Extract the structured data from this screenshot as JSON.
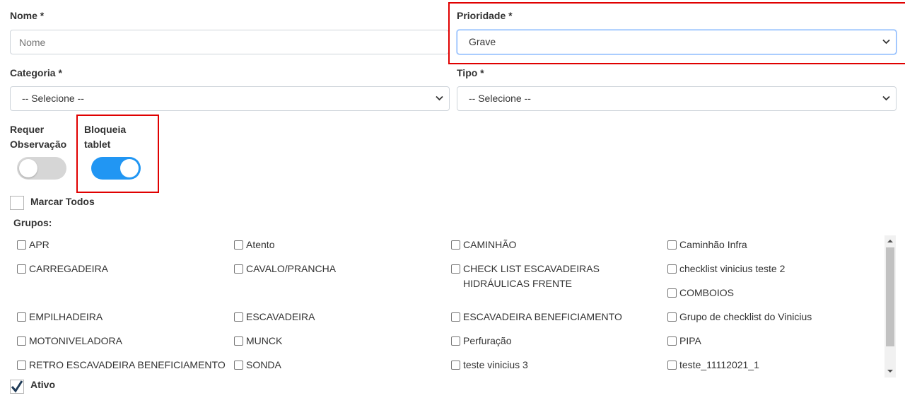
{
  "form": {
    "nome": {
      "label": "Nome *",
      "placeholder": "Nome",
      "value": ""
    },
    "prioridade": {
      "label": "Prioridade *",
      "value": "Grave"
    },
    "categoria": {
      "label": "Categoria *",
      "value": "-- Selecione --"
    },
    "tipo": {
      "label": "Tipo *",
      "value": "-- Selecione --"
    },
    "requer_observacao": {
      "label_line1": "Requer",
      "label_line2": "Observação",
      "checked": false
    },
    "bloqueia_tablet": {
      "label_line1": "Bloqueia",
      "label_line2": "tablet",
      "checked": true
    },
    "marcar_todos": {
      "label": "Marcar Todos",
      "checked": false
    },
    "grupos_label": "Grupos:",
    "ativo": {
      "label": "Ativo",
      "checked": true
    }
  },
  "groups": [
    [
      "APR",
      "Atento",
      "CAMINHÃO",
      "Caminhão Infra"
    ],
    [
      "CARREGADEIRA",
      "CAVALO/PRANCHA",
      "CHECK LIST ESCAVADEIRAS HIDRÁULICAS FRENTE",
      "checklist vinicius teste 2"
    ],
    [
      "",
      "",
      "",
      "COMBOIOS"
    ],
    [
      "EMPILHADEIRA",
      "ESCAVADEIRA",
      "ESCAVADEIRA BENEFICIAMENTO",
      "Grupo de checklist do Vinicius"
    ],
    [
      "MOTONIVELADORA",
      "MUNCK",
      "Perfuração",
      "PIPA"
    ],
    [
      "RETRO ESCAVADEIRA BENEFICIAMENTO",
      "SONDA",
      "teste vinicius 3",
      "teste_11112021_1"
    ]
  ],
  "colors": {
    "toggle_on": "#2196f3",
    "toggle_off": "#d6d6d6",
    "highlight": "#e00000"
  }
}
